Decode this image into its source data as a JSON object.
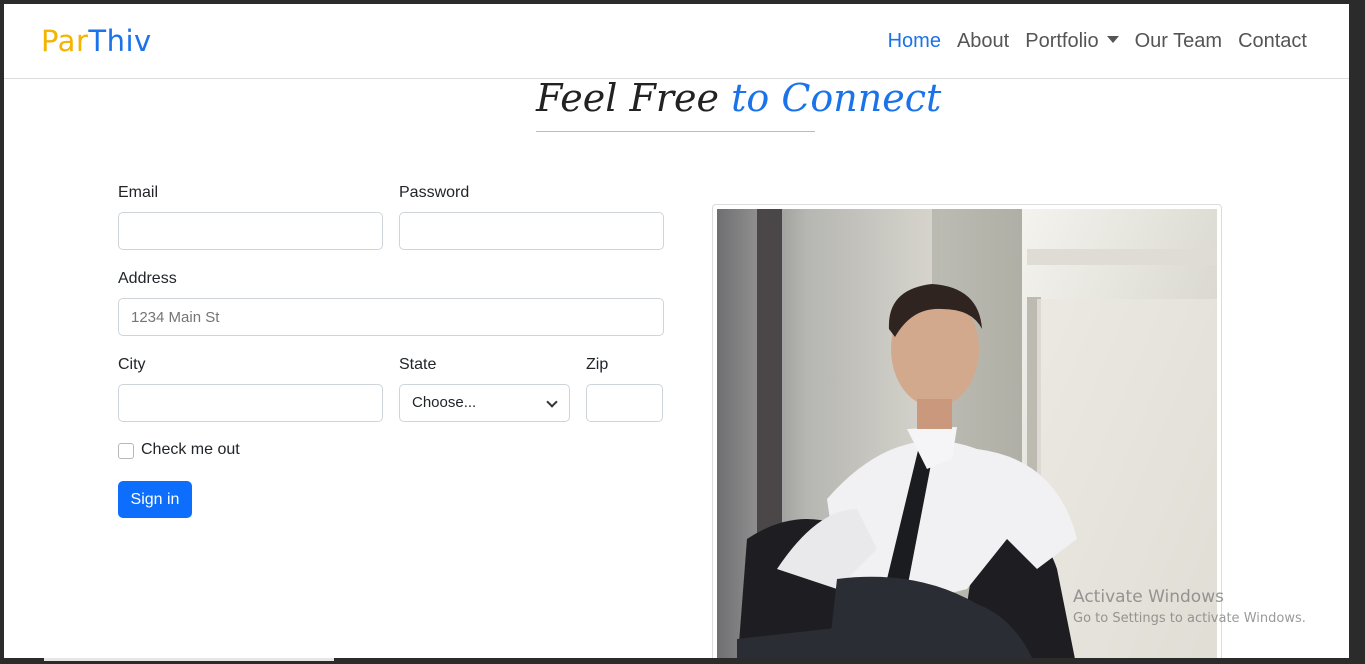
{
  "brand": {
    "part1": "Par",
    "part2": "Thiv"
  },
  "nav": {
    "home": "Home",
    "about": "About",
    "portfolio": "Portfolio",
    "team": "Our Team",
    "contact": "Contact"
  },
  "heading": {
    "part1": "Feel Free",
    "part2": " to Connect"
  },
  "form": {
    "email_label": "Email",
    "password_label": "Password",
    "address_label": "Address",
    "address_placeholder": "1234 Main St",
    "city_label": "City",
    "state_label": "State",
    "state_selected": "Choose...",
    "zip_label": "Zip",
    "checkbox_label": "Check me out",
    "submit_label": "Sign in"
  },
  "watermark": {
    "line1": "Activate Windows",
    "line2": "Go to Settings to activate Windows."
  },
  "colors": {
    "brand_yellow": "#f4b400",
    "brand_blue": "#1a73e8",
    "button_primary": "#0d6efd"
  },
  "icons": {
    "dropdown": "caret-down-icon",
    "select": "chevron-down-icon"
  }
}
